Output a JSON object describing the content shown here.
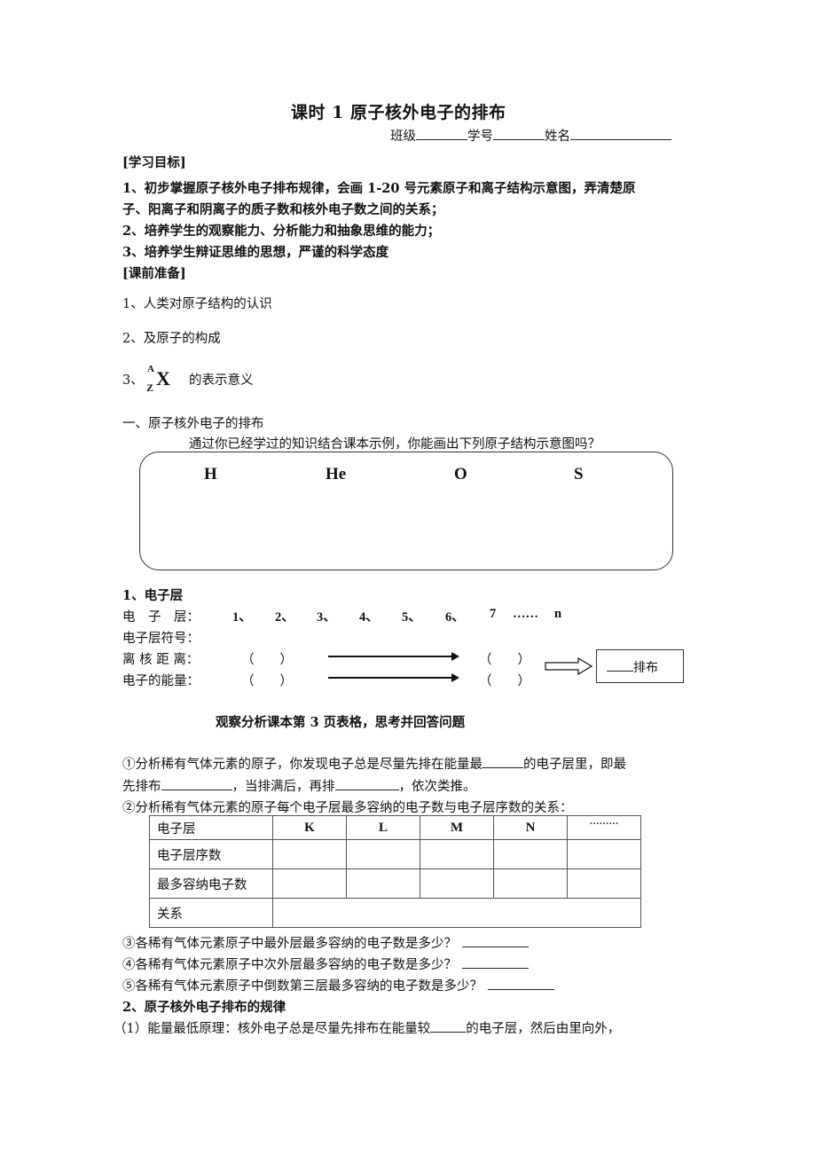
{
  "header": {
    "title": "课时 1  原子核外电子的排布",
    "class_label": "班级",
    "student_no_label": "学号",
    "name_label": "姓名"
  },
  "objectives": {
    "heading": "[学习目标]",
    "item1_line1": "1、初步掌握原子核外电子排布规律，会画 1-20 号元素原子和离子结构示意图，弄清楚原",
    "item1_line2": "子、阳离子和阴离子的质子数和核外电子数之间的关系；",
    "item2": "2、培养学生的观察能力、分析能力和抽象思维的能力；",
    "item3": "3、培养学生辩证思维的思想，严谨的科学态度"
  },
  "preparation": {
    "heading": "[课前准备]",
    "item1": "1、人类对原子结构的认识",
    "item2": "2、及原子的构成",
    "item3_prefix": "3、",
    "nuclide_mass": "A",
    "nuclide_atomic": "Z",
    "nuclide_symbol": "X",
    "item3_suffix": "的表示意义"
  },
  "section1": {
    "heading": "一、原子核外电子的排布",
    "prompt": "通过你已经学过的知识结合课本示例，你能画出下列原子结构示意图吗？",
    "elements": [
      "H",
      "He",
      "O",
      "S"
    ]
  },
  "shells": {
    "heading": "1、电子层",
    "row_label_shell": "电　子　层：",
    "shell_numbers": [
      "1、",
      "2、",
      "3、",
      "4、",
      "5、",
      "6、",
      "7",
      "……",
      "n"
    ],
    "row_label_symbol": "电子层符号：",
    "row_label_distance": "离 核 距 离：",
    "row_label_energy": "电子的能量：",
    "paren_left": "（　　）",
    "paren_right": "（　　）",
    "result_text": "排布"
  },
  "observe": {
    "instruction": "观察分析课本第 3 页表格，思考并回答问题",
    "q1_line1_a": "①分析稀有气体元素的原子，你发现电子总是尽量先排在能量最",
    "q1_line1_b": "的电子层里，即最",
    "q1_line2_a": "先排布",
    "q1_line2_b": "，当排满后，再排",
    "q1_line2_c": "，依次类推。",
    "q2": "②分析稀有气体元素的原子每个电子层最多容纳的电子数与电子层序数的关系："
  },
  "table": {
    "row_headers": [
      "电子层",
      "电子层序数",
      "最多容纳电子数",
      "关系"
    ],
    "column_headers": [
      "K",
      "L",
      "M",
      "N",
      "………"
    ]
  },
  "questions": {
    "q3": "③各稀有气体元素原子中最外层最多容纳的电子数是多少？",
    "q4": "④各稀有气体元素原子中次外层最多容纳的电子数是多少？",
    "q5": "⑤各稀有气体元素原子中倒数第三层最多容纳的电子数是多少？"
  },
  "rules": {
    "heading": "2、原子核外电子排布的规律",
    "rule1_a": "（1）能量最低原理：核外电子总是尽量先排布在能量较",
    "rule1_b": "的电子层，然后由里向外，"
  }
}
